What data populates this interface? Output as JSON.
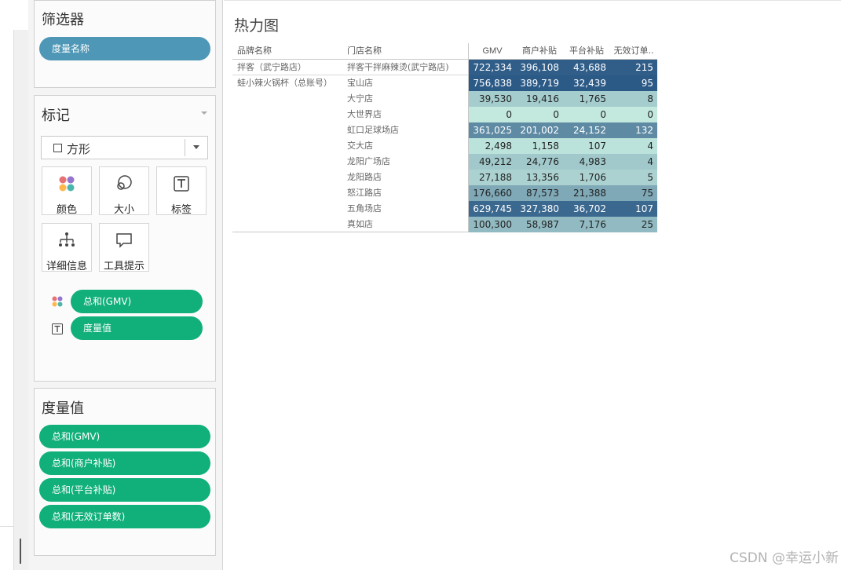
{
  "filters": {
    "title": "筛选器",
    "pills": [
      "度量名称"
    ]
  },
  "marks": {
    "title": "标记",
    "mark_type": "方形",
    "buttons": [
      {
        "label": "颜色",
        "icon": "color-icon"
      },
      {
        "label": "大小",
        "icon": "size-icon"
      },
      {
        "label": "标签",
        "icon": "label-icon"
      },
      {
        "label": "详细信息",
        "icon": "detail-icon"
      },
      {
        "label": "工具提示",
        "icon": "tooltip-icon"
      }
    ],
    "fields": [
      {
        "icon": "color-icon",
        "label": "总和(GMV)"
      },
      {
        "icon": "label-icon",
        "label": "度量值"
      }
    ]
  },
  "measure_values": {
    "title": "度量值",
    "pills": [
      "总和(GMV)",
      "总和(商户补贴)",
      "总和(平台补贴)",
      "总和(无效订单数)"
    ]
  },
  "view": {
    "title": "热力图",
    "headers": {
      "brand": "品牌名称",
      "store": "门店名称",
      "measures": [
        "GMV",
        "商户补贴",
        "平台补贴",
        "无效订单.."
      ]
    },
    "brands": [
      "拌客（武宁路店）",
      "蛙小辣火锅杯（总账号）"
    ],
    "rows": [
      {
        "store": "拌客干拌麻辣烫(武宁路店)",
        "values": [
          "722,334",
          "396,108",
          "43,688",
          "215"
        ],
        "gmv": 722334
      },
      {
        "store": "宝山店",
        "values": [
          "756,838",
          "389,719",
          "32,439",
          "95"
        ],
        "gmv": 756838
      },
      {
        "store": "大宁店",
        "values": [
          "39,530",
          "19,416",
          "1,765",
          "8"
        ],
        "gmv": 39530
      },
      {
        "store": "大世界店",
        "values": [
          "0",
          "0",
          "0",
          "0"
        ],
        "gmv": 0
      },
      {
        "store": "虹口足球场店",
        "values": [
          "361,025",
          "201,002",
          "24,152",
          "132"
        ],
        "gmv": 361025
      },
      {
        "store": "交大店",
        "values": [
          "2,498",
          "1,158",
          "107",
          "4"
        ],
        "gmv": 2498
      },
      {
        "store": "龙阳广场店",
        "values": [
          "49,212",
          "24,776",
          "4,983",
          "4"
        ],
        "gmv": 49212
      },
      {
        "store": "龙阳路店",
        "values": [
          "27,188",
          "13,356",
          "1,706",
          "5"
        ],
        "gmv": 27188
      },
      {
        "store": "怒江路店",
        "values": [
          "176,660",
          "87,573",
          "21,388",
          "75"
        ],
        "gmv": 176660
      },
      {
        "store": "五角场店",
        "values": [
          "629,745",
          "327,380",
          "36,702",
          "107"
        ],
        "gmv": 629745
      },
      {
        "store": "真如店",
        "values": [
          "100,300",
          "58,987",
          "7,176",
          "25"
        ],
        "gmv": 100300
      }
    ],
    "color_scale": {
      "low": "#c3e9df",
      "high": "#2c5a87"
    }
  },
  "watermark": "CSDN @幸运小新"
}
